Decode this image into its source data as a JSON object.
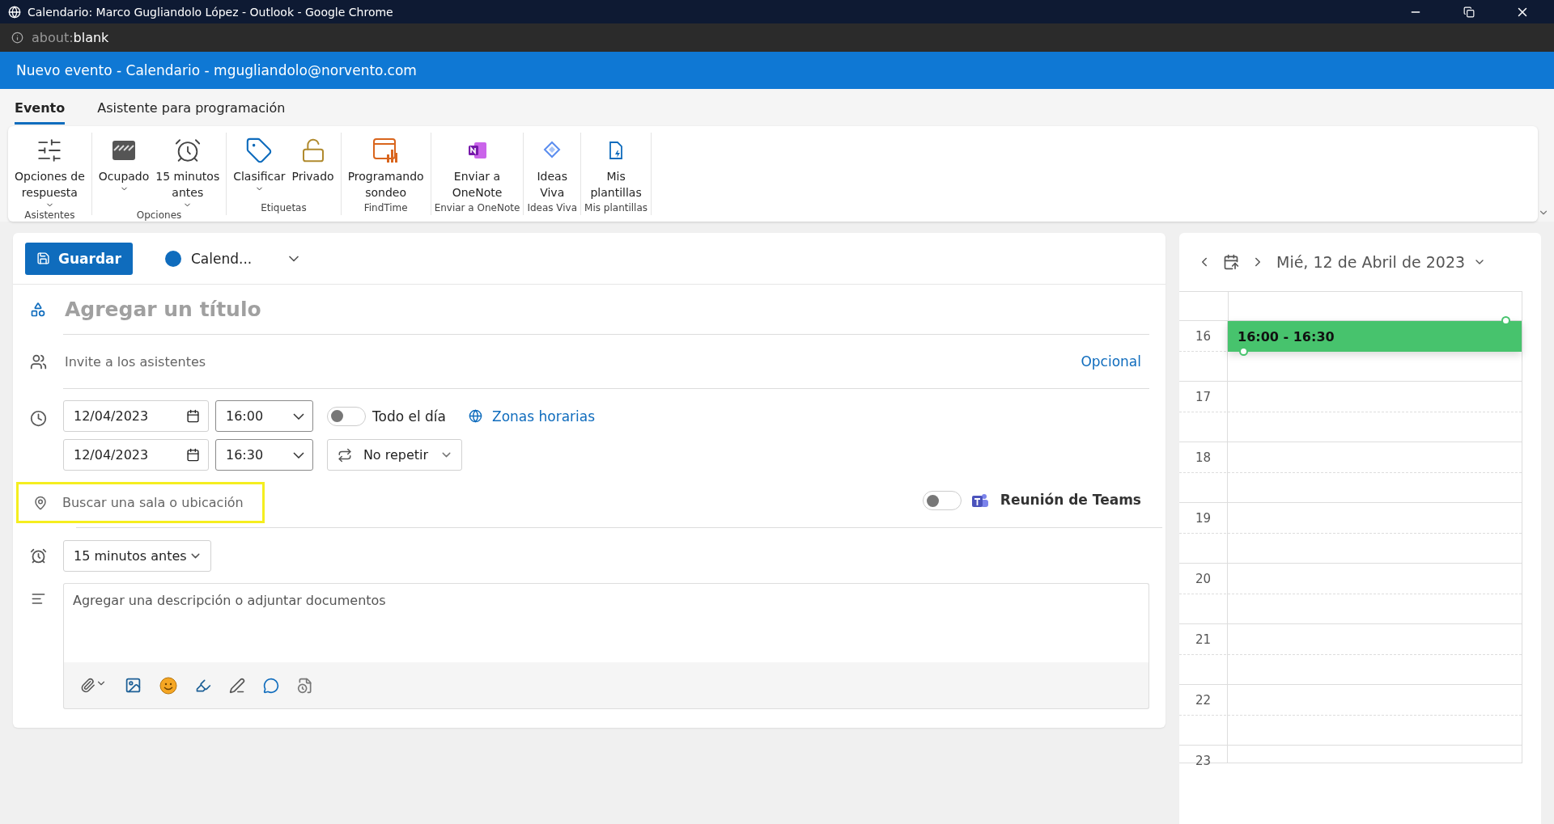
{
  "browser": {
    "title": "Calendario: Marco Gugliandolo López - Outlook - Google Chrome",
    "address": {
      "scheme": "about:",
      "rest": "blank"
    }
  },
  "app_header": {
    "title": "Nuevo evento - Calendario - mgugliandolo@norvento.com"
  },
  "tabs": [
    {
      "label": "Evento",
      "selected": true
    },
    {
      "label": "Asistente para programación",
      "selected": false
    }
  ],
  "ribbon": {
    "groups": [
      {
        "label": "Asistentes",
        "buttons": [
          {
            "lines": [
              "Opciones de",
              "respuesta"
            ],
            "dropdown": true,
            "kind": "sliders"
          }
        ]
      },
      {
        "label": "Opciones",
        "buttons": [
          {
            "lines": [
              "Ocupado"
            ],
            "dropdown": true,
            "kind": "busy"
          },
          {
            "lines": [
              "15 minutos",
              "antes"
            ],
            "dropdown": true,
            "kind": "alarm"
          }
        ]
      },
      {
        "label": "Etiquetas",
        "buttons": [
          {
            "lines": [
              "Clasificar"
            ],
            "dropdown": true,
            "kind": "tag"
          },
          {
            "lines": [
              "Privado"
            ],
            "dropdown": false,
            "kind": "lock"
          }
        ]
      },
      {
        "label": "FindTime",
        "buttons": [
          {
            "lines": [
              "Programando",
              "sondeo"
            ],
            "dropdown": false,
            "kind": "poll"
          }
        ]
      },
      {
        "label": "Enviar a OneNote",
        "buttons": [
          {
            "lines": [
              "Enviar a",
              "OneNote"
            ],
            "dropdown": false,
            "kind": "onenote"
          }
        ]
      },
      {
        "label": "Ideas Viva",
        "buttons": [
          {
            "lines": [
              "Ideas",
              "Viva"
            ],
            "dropdown": false,
            "kind": "viva"
          }
        ]
      },
      {
        "label": "Mis plantillas",
        "buttons": [
          {
            "lines": [
              "Mis",
              "plantillas"
            ],
            "dropdown": false,
            "kind": "template"
          }
        ]
      }
    ]
  },
  "form": {
    "save_button": "Guardar",
    "calendar": "Calend...",
    "title_placeholder": "Agregar un título",
    "attendees_placeholder": "Invite a los asistentes",
    "optional_link": "Opcional",
    "start": {
      "date": "12/04/2023",
      "time": "16:00"
    },
    "end": {
      "date": "12/04/2023",
      "time": "16:30"
    },
    "all_day": {
      "label": "Todo el día",
      "on": false
    },
    "time_zones": "Zonas horarias",
    "repeat": "No repetir",
    "location": {
      "placeholder": "Buscar una sala o ubicación",
      "highlighted": true
    },
    "teams": {
      "label": "Reunión de Teams",
      "on": false
    },
    "reminder": "15 minutos antes",
    "description_placeholder": "Agregar una descripción o adjuntar documentos"
  },
  "calendar_pane": {
    "date": "Mié, 12 de Abril de 2023",
    "hours": [
      "16",
      "17",
      "18",
      "19",
      "20",
      "21",
      "22",
      "23"
    ],
    "event": {
      "time": "16:00 - 16:30"
    }
  }
}
